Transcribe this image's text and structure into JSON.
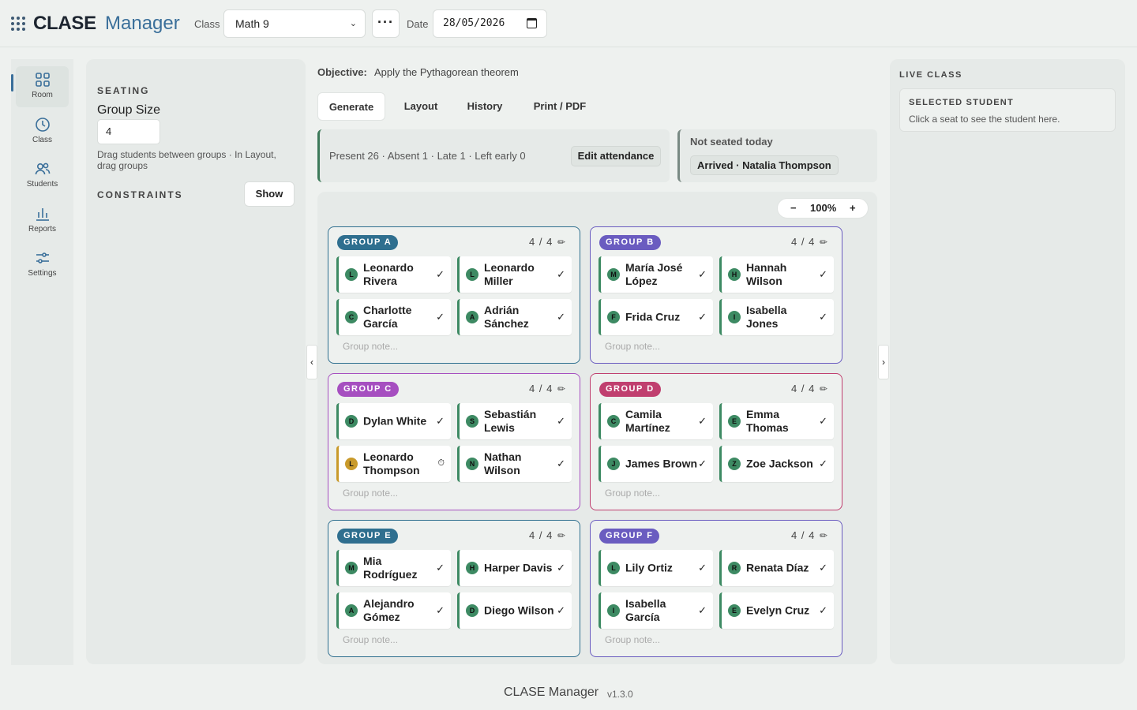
{
  "header": {
    "brand_bold": "CLASE",
    "brand_light": "Manager",
    "class_label": "Class",
    "class_value": "Math 9",
    "more_label": "···",
    "date_label": "Date",
    "date_value": "28/05/2026"
  },
  "nav": {
    "items": [
      {
        "label": "Room",
        "icon": "grid-icon",
        "active": true
      },
      {
        "label": "Class",
        "icon": "clock-icon"
      },
      {
        "label": "Students",
        "icon": "users-icon"
      },
      {
        "label": "Reports",
        "icon": "bar-chart-icon"
      },
      {
        "label": "Settings",
        "icon": "sliders-icon"
      }
    ]
  },
  "seating": {
    "heading": "SEATING",
    "group_size_label": "Group Size",
    "group_size_value": "4",
    "hint": "Drag students between groups · In Layout, drag groups",
    "constraints_label": "CONSTRAINTS",
    "show_label": "Show"
  },
  "main": {
    "objective_label": "Objective:",
    "objective_text": "Apply the Pythagorean theorem",
    "tabs": [
      {
        "label": "Generate",
        "active": true
      },
      {
        "label": "Layout"
      },
      {
        "label": "History"
      },
      {
        "label": "Print / PDF"
      }
    ],
    "attendance": {
      "summary": "Present 26 · Absent 1 · Late 1 · Left early 0",
      "edit_label": "Edit attendance"
    },
    "not_seated": {
      "title": "Not seated today",
      "entry": "Arrived · Natalia Thompson"
    },
    "zoom": {
      "minus": "−",
      "value": "100%",
      "plus": "+"
    },
    "left_handle": "‹",
    "right_handle": "›"
  },
  "groups": [
    {
      "name": "GROUP A",
      "count": "4 / 4",
      "color": "#2f6f8f",
      "note": "Group note...",
      "students": [
        {
          "initial": "L",
          "name": "Leonardo Rivera",
          "status": "✓"
        },
        {
          "initial": "L",
          "name": "Leonardo Miller",
          "status": "✓"
        },
        {
          "initial": "C",
          "name": "Charlotte García",
          "status": "✓"
        },
        {
          "initial": "A",
          "name": "Adrián Sánchez",
          "status": "✓"
        }
      ]
    },
    {
      "name": "GROUP B",
      "count": "4 / 4",
      "color": "#6a5cc0",
      "note": "Group note...",
      "students": [
        {
          "initial": "M",
          "name": "María José López",
          "status": "✓"
        },
        {
          "initial": "H",
          "name": "Hannah Wilson",
          "status": "✓"
        },
        {
          "initial": "F",
          "name": "Frida Cruz",
          "status": "✓"
        },
        {
          "initial": "I",
          "name": "Isabella Jones",
          "status": "✓"
        }
      ]
    },
    {
      "name": "GROUP C",
      "count": "4 / 4",
      "color": "#a64fc0",
      "note": "Group note...",
      "students": [
        {
          "initial": "D",
          "name": "Dylan White",
          "status": "✓"
        },
        {
          "initial": "S",
          "name": "Sebastián Lewis",
          "status": "✓"
        },
        {
          "initial": "L",
          "name": "Leonardo Thompson",
          "status": "⏱",
          "late": true
        },
        {
          "initial": "N",
          "name": "Nathan Wilson",
          "status": "✓"
        }
      ]
    },
    {
      "name": "GROUP D",
      "count": "4 / 4",
      "color": "#c03f6f",
      "note": "Group note...",
      "students": [
        {
          "initial": "C",
          "name": "Camila Martínez",
          "status": "✓"
        },
        {
          "initial": "E",
          "name": "Emma Thomas",
          "status": "✓"
        },
        {
          "initial": "J",
          "name": "James Brown",
          "status": "✓"
        },
        {
          "initial": "Z",
          "name": "Zoe Jackson",
          "status": "✓"
        }
      ]
    },
    {
      "name": "GROUP E",
      "count": "4 / 4",
      "color": "#2f6f8f",
      "note": "Group note...",
      "students": [
        {
          "initial": "M",
          "name": "Mia Rodríguez",
          "status": "✓"
        },
        {
          "initial": "H",
          "name": "Harper Davis",
          "status": "✓"
        },
        {
          "initial": "A",
          "name": "Alejandro Gómez",
          "status": "✓"
        },
        {
          "initial": "D",
          "name": "Diego Wilson",
          "status": "✓"
        }
      ]
    },
    {
      "name": "GROUP F",
      "count": "4 / 4",
      "color": "#6a5cc0",
      "note": "Group note...",
      "students": [
        {
          "initial": "L",
          "name": "Lily Ortiz",
          "status": "✓"
        },
        {
          "initial": "R",
          "name": "Renata Díaz",
          "status": "✓"
        },
        {
          "initial": "I",
          "name": "Isabella García",
          "status": "✓"
        },
        {
          "initial": "E",
          "name": "Evelyn Cruz",
          "status": "✓"
        }
      ]
    }
  ],
  "live": {
    "heading": "LIVE CLASS",
    "selected_label": "SELECTED STUDENT",
    "selected_hint": "Click a seat to see the student here."
  },
  "footer": {
    "title": "CLASE Manager",
    "version": "v1.3.0"
  }
}
